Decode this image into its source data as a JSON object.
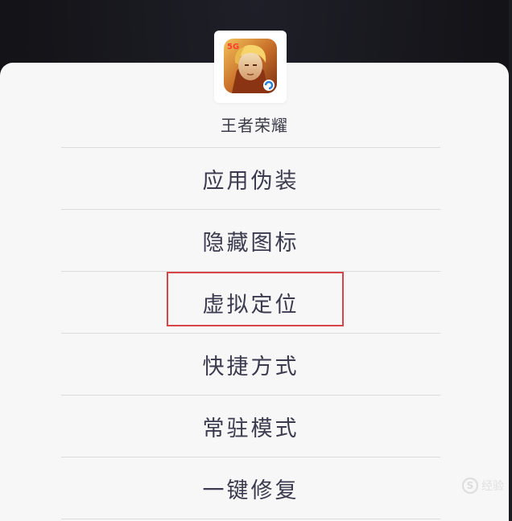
{
  "app": {
    "name": "王者荣耀",
    "icon": "game-app-icon"
  },
  "menu": [
    {
      "label": "应用伪装"
    },
    {
      "label": "隐藏图标"
    },
    {
      "label": "虚拟定位"
    },
    {
      "label": "快捷方式"
    },
    {
      "label": "常驻模式"
    },
    {
      "label": "一键修复"
    }
  ],
  "highlight": {
    "target": "虚拟定位",
    "color": "#d9434a"
  },
  "watermark": {
    "text": "经验",
    "icon": "s-logo-icon"
  },
  "colors": {
    "sheet": "#f7f7f7",
    "background": "#141419",
    "text": "#3b3a4e",
    "divider": "#dcdcdc"
  }
}
